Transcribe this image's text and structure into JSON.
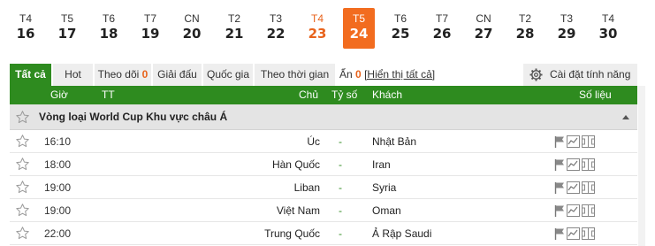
{
  "dates": [
    {
      "dow": "T4",
      "day": "16",
      "state": "normal"
    },
    {
      "dow": "T5",
      "day": "17",
      "state": "normal"
    },
    {
      "dow": "T6",
      "day": "18",
      "state": "normal"
    },
    {
      "dow": "T7",
      "day": "19",
      "state": "normal"
    },
    {
      "dow": "CN",
      "day": "20",
      "state": "normal"
    },
    {
      "dow": "T2",
      "day": "21",
      "state": "normal"
    },
    {
      "dow": "T3",
      "day": "22",
      "state": "normal"
    },
    {
      "dow": "T4",
      "day": "23",
      "state": "today"
    },
    {
      "dow": "T5",
      "day": "24",
      "state": "selected"
    },
    {
      "dow": "T6",
      "day": "25",
      "state": "normal"
    },
    {
      "dow": "T7",
      "day": "26",
      "state": "normal"
    },
    {
      "dow": "CN",
      "day": "27",
      "state": "normal"
    },
    {
      "dow": "T2",
      "day": "28",
      "state": "normal"
    },
    {
      "dow": "T3",
      "day": "29",
      "state": "normal"
    },
    {
      "dow": "T4",
      "day": "30",
      "state": "normal"
    }
  ],
  "tabs": {
    "all": "Tất cả",
    "hot": "Hot",
    "following": "Theo dõi",
    "following_count": "0",
    "tournament": "Giải đấu",
    "country": "Quốc gia",
    "by_time": "Theo thời gian"
  },
  "hidden": {
    "label": "Ẩn",
    "count": "0",
    "show_all": "[Hiển thị tất cả]"
  },
  "settings_label": "Cài đặt tính năng",
  "columns": {
    "time": "Giờ",
    "status": "TT",
    "home": "Chủ",
    "score": "Tỷ số",
    "away": "Khách",
    "stats": "Số liệu"
  },
  "league": "Vòng loại World Cup Khu vực châu Á",
  "matches": [
    {
      "time": "16:10",
      "home": "Úc",
      "score": "-",
      "away": "Nhật Bản"
    },
    {
      "time": "18:00",
      "home": "Hàn Quốc",
      "score": "-",
      "away": "Iran"
    },
    {
      "time": "19:00",
      "home": "Liban",
      "score": "-",
      "away": "Syria"
    },
    {
      "time": "19:00",
      "home": "Việt Nam",
      "score": "-",
      "away": "Oman"
    },
    {
      "time": "22:00",
      "home": "Trung Quốc",
      "score": "-",
      "away": "Ả Rập Saudi"
    }
  ],
  "icons": {
    "favorite": "star-icon",
    "flag": "flag-icon",
    "chart": "line-chart-icon",
    "field": "pitch-icon",
    "settings": "gear-icon",
    "collapse": "caret-up-icon"
  },
  "colors": {
    "accent_green": "#2e8b1f",
    "selected_orange": "#f26c1f",
    "highlight_orange": "#e8631c"
  }
}
